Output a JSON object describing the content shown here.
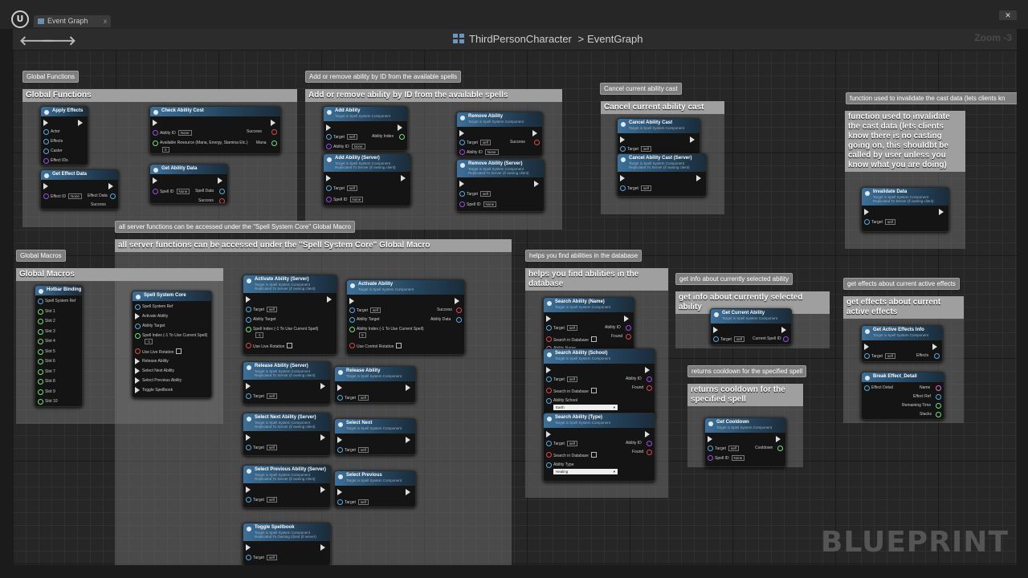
{
  "window": {
    "tab_label": "Event Graph",
    "tab_close": "x",
    "close_button": "✕"
  },
  "header": {
    "back": "🡐",
    "forward": "🡒",
    "breadcrumb_root": "ThirdPersonCharacter",
    "breadcrumb_sep": ">",
    "breadcrumb_leaf": "EventGraph",
    "zoom": "Zoom -3"
  },
  "watermark": "BLUEPRINT",
  "comments": {
    "global_functions": "Global Functions",
    "add_remove": "Add or remove ability by ID from the available spells",
    "cancel_cast": "Cancel current ability cast",
    "invalidate_bubble": "function used to invalidate the cast data (lets clients kn",
    "invalidate_head": "function used to invalidate the cast data (lets clients know there is no casting going on, this shouldbt be called by user unless you know what you are doing)",
    "server_functions": "all server  functions can be accessed under the \"Spell System Core\" Global Macro",
    "global_macros": "Global Macros",
    "find_abilities": "helps you find abilities in the database",
    "selected_info": "get info about currently selected ability",
    "active_effects": "get effects about current active effects",
    "cooldown": "returns cooldown for the specified spell"
  },
  "common": {
    "target": "Target",
    "self": "self",
    "none": "None",
    "success": "Success",
    "found": "Found",
    "ability_id": "Ability ID",
    "spell_id": "Spell ID"
  },
  "nodes": {
    "apply_effects": {
      "title": "Apply Effects",
      "pins": [
        "Actor",
        "Effects",
        "Caster",
        "Effect IDs"
      ]
    },
    "check_ability_cost": {
      "title": "Check Ability Cost",
      "ability_id": "Ability ID",
      "success": "Success",
      "resource": "Available Resource (Mana, Energy, Stamina Etc.)",
      "resource_val": "0",
      "mana": "Mana"
    },
    "get_effect_data": {
      "title": "Get Effect Data",
      "effect_id": "Effect ID",
      "effect_data": "Effect Data",
      "success": "Success"
    },
    "get_ability_data": {
      "title": "Get Ability Data",
      "spell_id": "Spell ID",
      "spell_data": "Spell Data",
      "success": "Success"
    },
    "add_ability": {
      "title": "Add Ability",
      "sub": "Target is Spell System Component",
      "ability_index": "Ability Index"
    },
    "add_ability_server": {
      "title": "Add Ability (Server)",
      "sub": "Target is Spell System Component\nReplicated To Server (if owning client)"
    },
    "remove_ability": {
      "title": "Remove Ability",
      "sub": "Target is Spell System Component"
    },
    "remove_ability_server": {
      "title": "Remove Ability (Server)",
      "sub": "Target is Spell System Component\nReplicated To Server (if owning client)"
    },
    "cancel_ability_cast": {
      "title": "Cancel Ability Cast",
      "sub": "Target is Spell System Component"
    },
    "cancel_ability_cast_server": {
      "title": "Cancel Ability Cast (Server)",
      "sub": "Target is Spell System Component\nReplicated To Server (if owning client)"
    },
    "invalidate_data": {
      "title": "Invalidate Data",
      "sub": "Target is Spell System Component\nReplicated To Server (if owning client)"
    },
    "hotbar_binding": {
      "title": "Hotbar Binding",
      "pins": [
        "Spell System Ref",
        "Slot 1",
        "Slot 2",
        "Slot 3",
        "Slot 4",
        "Slot 5",
        "Slot 6",
        "Slot 7",
        "Slot 8",
        "Slot 9",
        "Slot 10"
      ]
    },
    "spell_system_core": {
      "title": "Spell System Core",
      "pins": [
        "Spell System Ref",
        "Activate Ability",
        "Ability Target",
        "Spell Index (-1 To Use Current Spell)",
        "Use Live Rotation",
        "Release Ability",
        "Select Next Ability",
        "Select Previous Ability",
        "Toggle Spellbook"
      ],
      "spell_index_val": "-1"
    },
    "activate_ability_server": {
      "title": "Activate Ability (Server)",
      "sub": "Target is Spell System Component\nReplicated To Server (if owning client)",
      "ability_target": "Ability Target",
      "spell_index": "Spell Index (-1 To Use Current Spell)",
      "spell_index_val": "-1",
      "live_rotation": "Use Live Rotation"
    },
    "activate_ability": {
      "title": "Activate Ability",
      "sub": "Target is Spell System Component",
      "ability_target": "Ability Target",
      "ability_index": "Ability Index (-1 To Use Current Spell)",
      "ability_index_val": "0",
      "control_rotation": "Use Control Rotation",
      "ability_data": "Ability Data"
    },
    "release_ability_server": {
      "title": "Release Ability (Server)",
      "sub": "Target is Spell System Component\nReplicated To Server (if owning client)"
    },
    "release_ability": {
      "title": "Release Ability",
      "sub": "Target is Spell System Component"
    },
    "select_next_server": {
      "title": "Select Next Ability (Server)",
      "sub": "Target is Spell System Component\nReplicated To Server (if owning client)"
    },
    "select_next": {
      "title": "Select Next",
      "sub": "Target is Spell System Component"
    },
    "select_previous_server": {
      "title": "Select Previous Ability (Server)",
      "sub": "Target is Spell System Component\nReplicated To Server (if owning client)"
    },
    "select_previous": {
      "title": "Select Previous",
      "sub": "Target is Spell System Component"
    },
    "toggle_spellbook": {
      "title": "Toggle Spellbook",
      "sub": "Target is Spell System Component\nReplicated To Owning Client (if server)"
    },
    "search_ability_name": {
      "title": "Search Ability (Name)",
      "sub": "Target is Spell System Component",
      "search_db": "Search in Database",
      "ability_name": "Ability Name"
    },
    "search_ability_school": {
      "title": "Search Ability (School)",
      "sub": "Target is Spell System Component",
      "search_db": "Search in Database",
      "school_label": "Ability School",
      "school_val": "Earth"
    },
    "search_ability_type": {
      "title": "Search Ability (Type)",
      "sub": "Target is Spell System Component",
      "search_db": "Search in Database",
      "type_label": "Ability Type",
      "type_val": "Healing"
    },
    "get_current_ability": {
      "title": "Get Current Ability",
      "sub": "Target is Spell System Component",
      "current_spell_id": "Current Spell ID"
    },
    "get_active_effects_info": {
      "title": "Get Active Effects Info",
      "sub": "Target is Spell System Component",
      "effects": "Effects"
    },
    "break_effect_detail": {
      "title": "Break Effect_Detail",
      "effect_detail": "Effect Detail",
      "outputs": [
        "Name",
        "Effect Ref",
        "Remaining Time",
        "Stacks"
      ]
    },
    "get_cooldown": {
      "title": "Get Cooldown",
      "sub": "Target is Spell System Component",
      "cooldown": "Cooldown"
    }
  }
}
